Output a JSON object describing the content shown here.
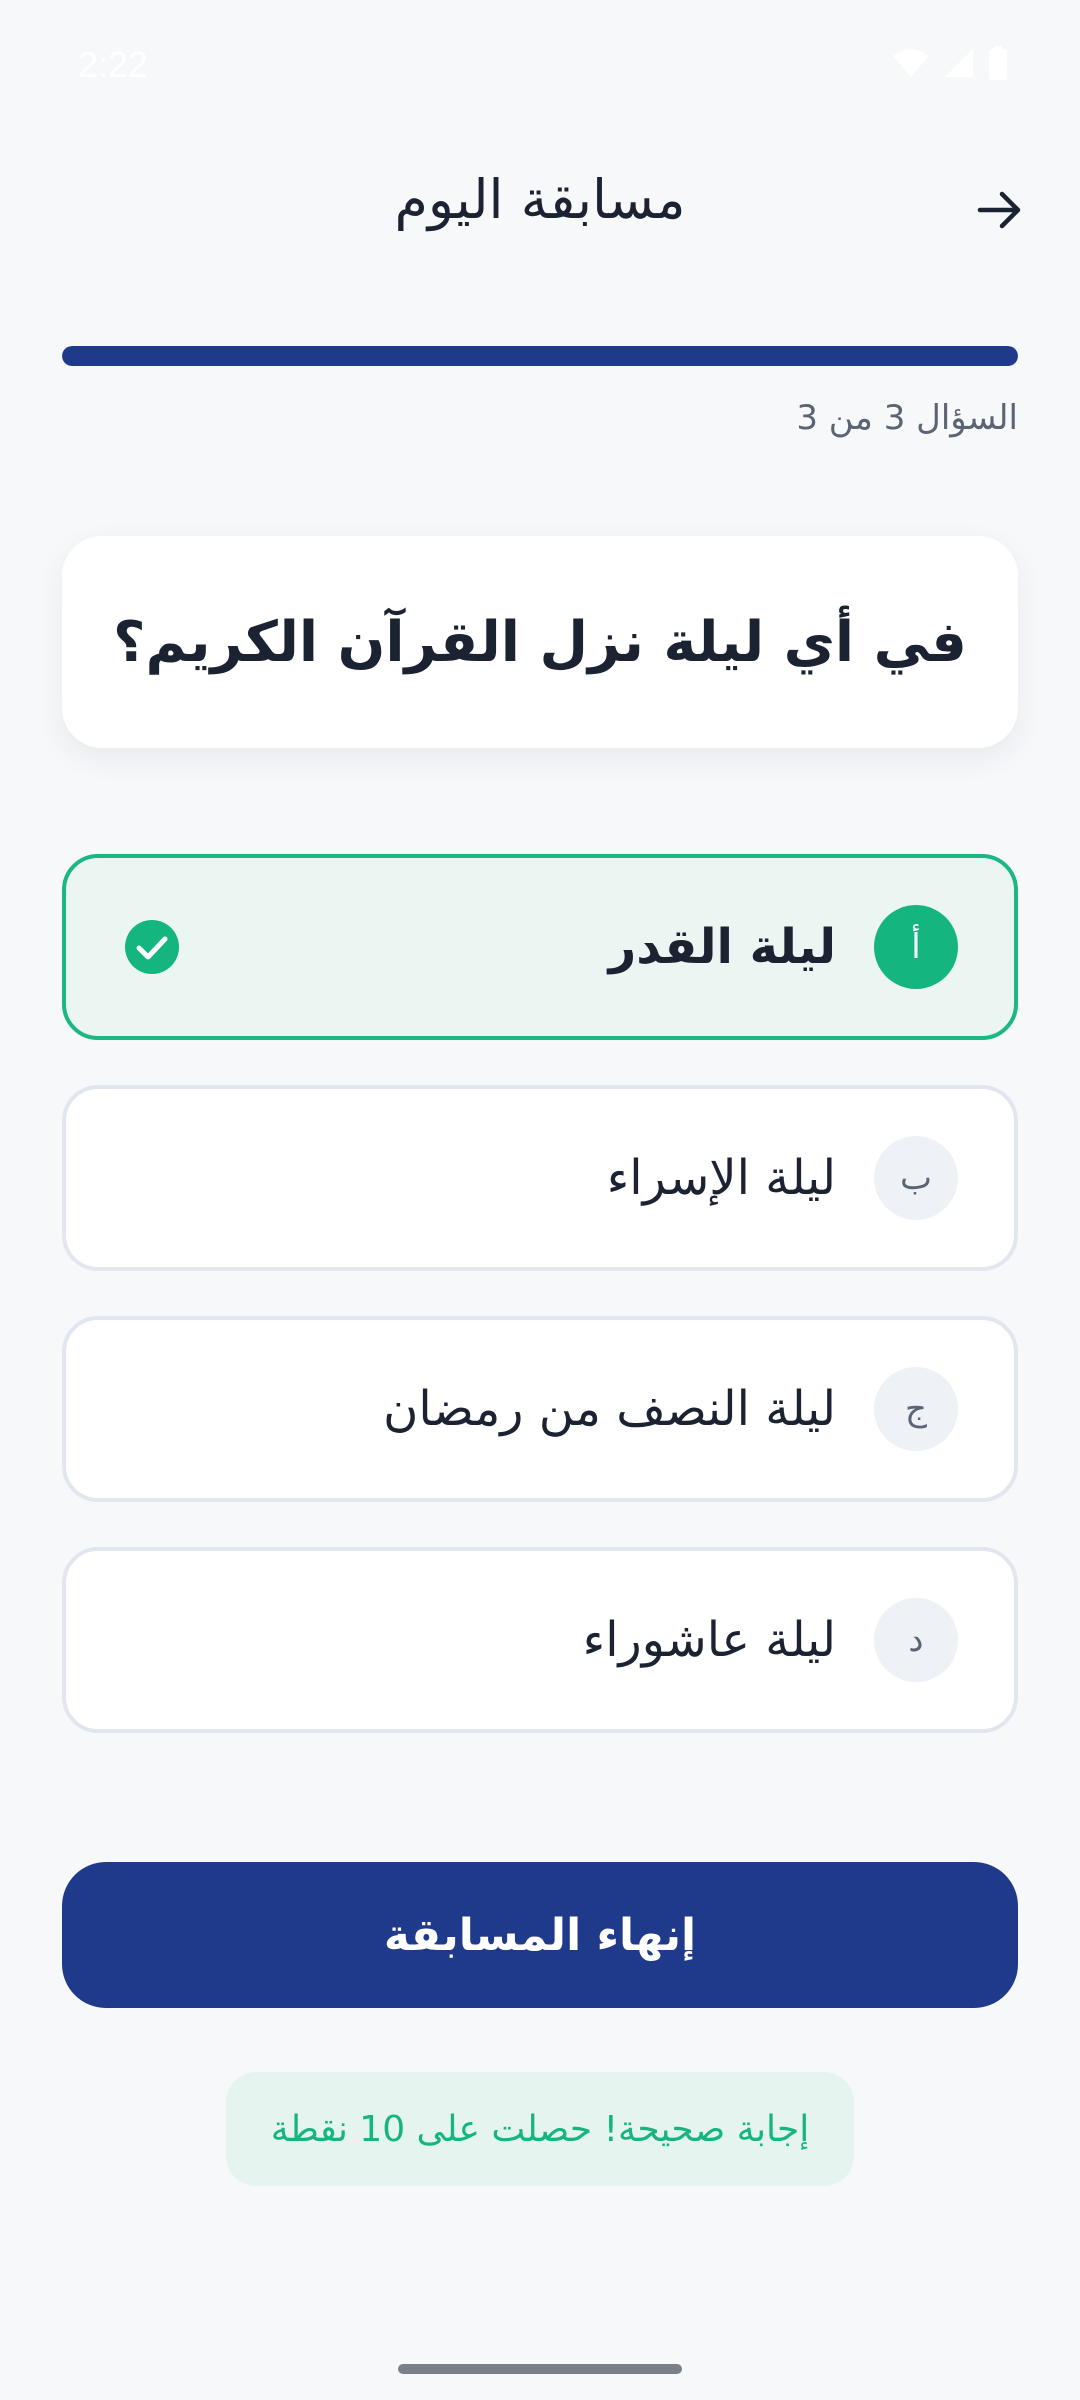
{
  "status_bar": {
    "time": "2:22",
    "icons": [
      "wifi-icon",
      "signal-icon",
      "battery-icon"
    ]
  },
  "header": {
    "title": "مسابقة اليوم",
    "back_icon": "arrow-right-icon"
  },
  "progress": {
    "label": "السؤال 3 من 3",
    "fraction": 1.0
  },
  "question": {
    "text": "في أي ليلة نزل القرآن الكريم؟"
  },
  "options": [
    {
      "letter": "أ",
      "text": "ليلة القدر",
      "state": "correct"
    },
    {
      "letter": "ب",
      "text": "ليلة الإسراء",
      "state": "default"
    },
    {
      "letter": "ج",
      "text": "ليلة النصف من رمضان",
      "state": "default"
    },
    {
      "letter": "د",
      "text": "ليلة عاشوراء",
      "state": "default"
    }
  ],
  "actions": {
    "finish_label": "إنهاء المسابقة"
  },
  "feedback": {
    "message": "إجابة صحيحة! حصلت على 10 نقطة"
  },
  "colors": {
    "primary": "#1F3A8A",
    "success": "#14B57F",
    "background": "#F7F8FA"
  }
}
